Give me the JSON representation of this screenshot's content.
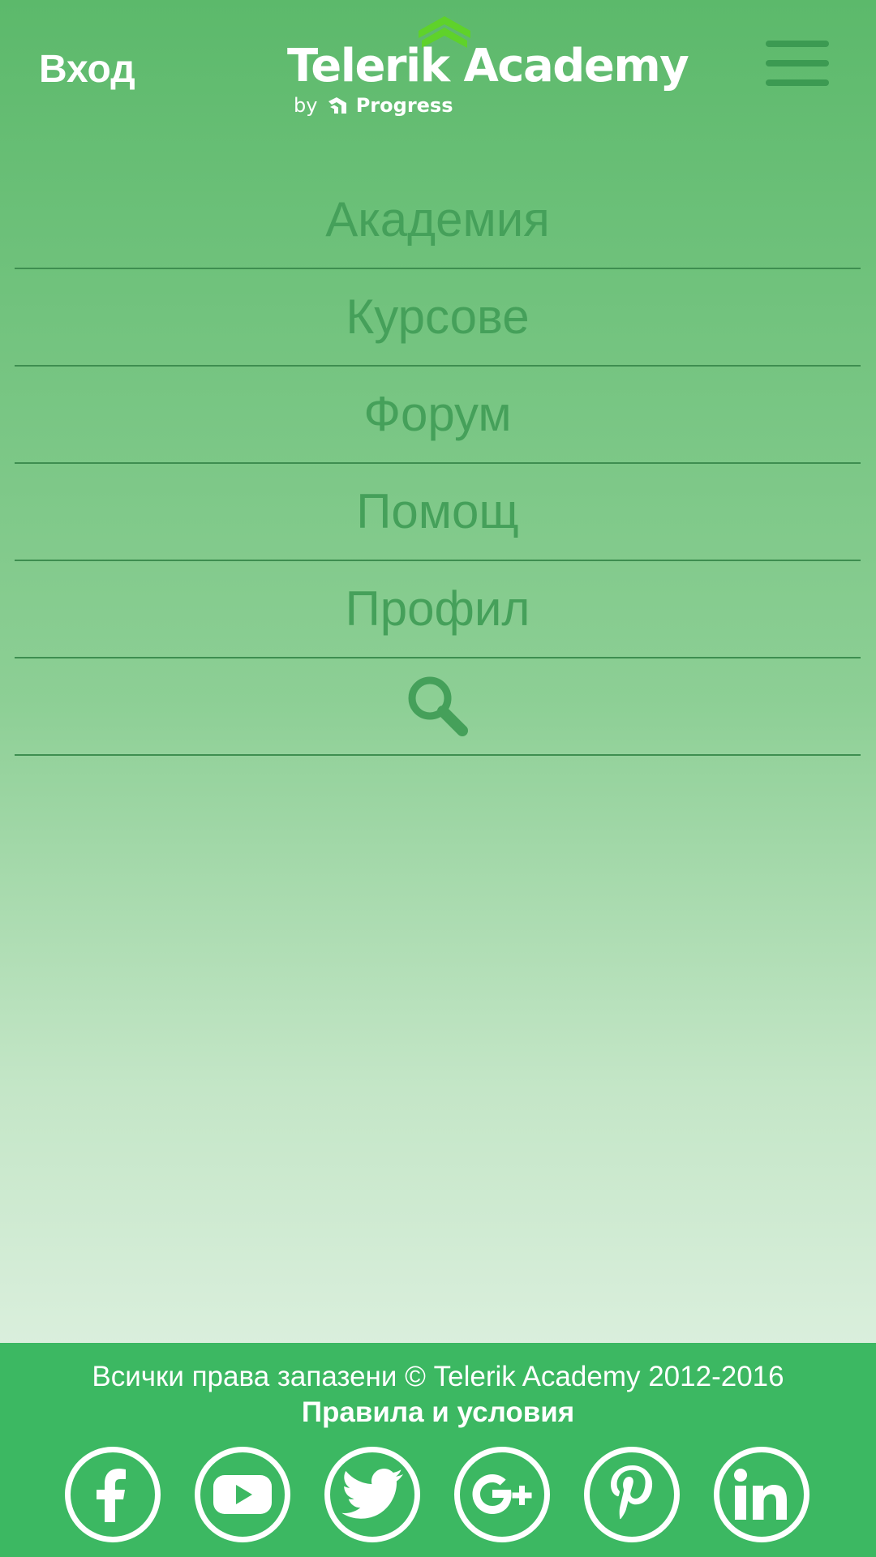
{
  "header": {
    "login_label": "Вход",
    "logo": {
      "title": "Telerik Academy",
      "by": "by",
      "brand": "Progress"
    }
  },
  "menu": {
    "items": [
      {
        "label": "Академия"
      },
      {
        "label": "Курсове"
      },
      {
        "label": "Форум"
      },
      {
        "label": "Помощ"
      },
      {
        "label": "Профил"
      }
    ],
    "search_icon": "search-icon"
  },
  "footer": {
    "copyright": "Всички права запазени © Telerik Academy 2012-2016",
    "terms": "Правила и условия",
    "socials": [
      "facebook-icon",
      "youtube-icon",
      "twitter-icon",
      "google-plus-icon",
      "pinterest-icon",
      "linkedin-icon"
    ]
  },
  "colors": {
    "accent_green": "#3cb862",
    "menu_text": "#45a05a",
    "divider": "#3e8e50",
    "chevron": "#5fd22a"
  }
}
